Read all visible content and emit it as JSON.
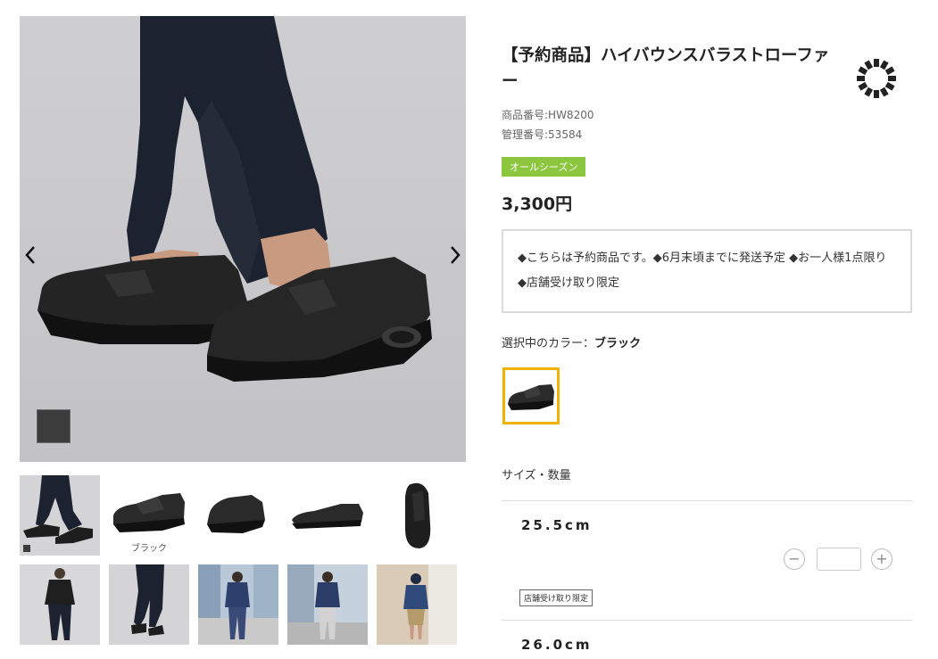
{
  "gallery": {
    "prev_icon": "chevron-left-icon",
    "next_icon": "chevron-right-icon",
    "chip_color": "#3c3c3c",
    "thumbnails_row1": [
      {
        "caption": "",
        "selected": true
      },
      {
        "caption": "ブラック",
        "selected": false
      },
      {
        "caption": "",
        "selected": false
      },
      {
        "caption": "",
        "selected": false
      },
      {
        "caption": "",
        "selected": false
      }
    ],
    "thumbnails_row2_count": 5
  },
  "product": {
    "title": "【予約商品】ハイバウンスバラストローファー",
    "item_number": "商品番号:HW8200",
    "control_number": "管理番号:53584",
    "season_badge": "オールシーズン",
    "price": "3,300円",
    "notice": "◆こちらは予約商品です。◆6月末頃までに発送予定 ◆お一人様1点限り ◆店舗受け取り限定",
    "color_label_prefix": "選択中のカラー：",
    "color_name": "ブラック",
    "size_heading": "サイズ・数量",
    "sizes": [
      {
        "label": "25.5cm",
        "quantity": "",
        "badge": "店舗受け取り限定"
      },
      {
        "label": "26.0cm"
      }
    ],
    "minus_label": "−",
    "plus_label": "+"
  },
  "colors": {
    "accent": "#f0b400",
    "badge_green": "#8cc63f",
    "image_bg": "#d4d4d6"
  }
}
